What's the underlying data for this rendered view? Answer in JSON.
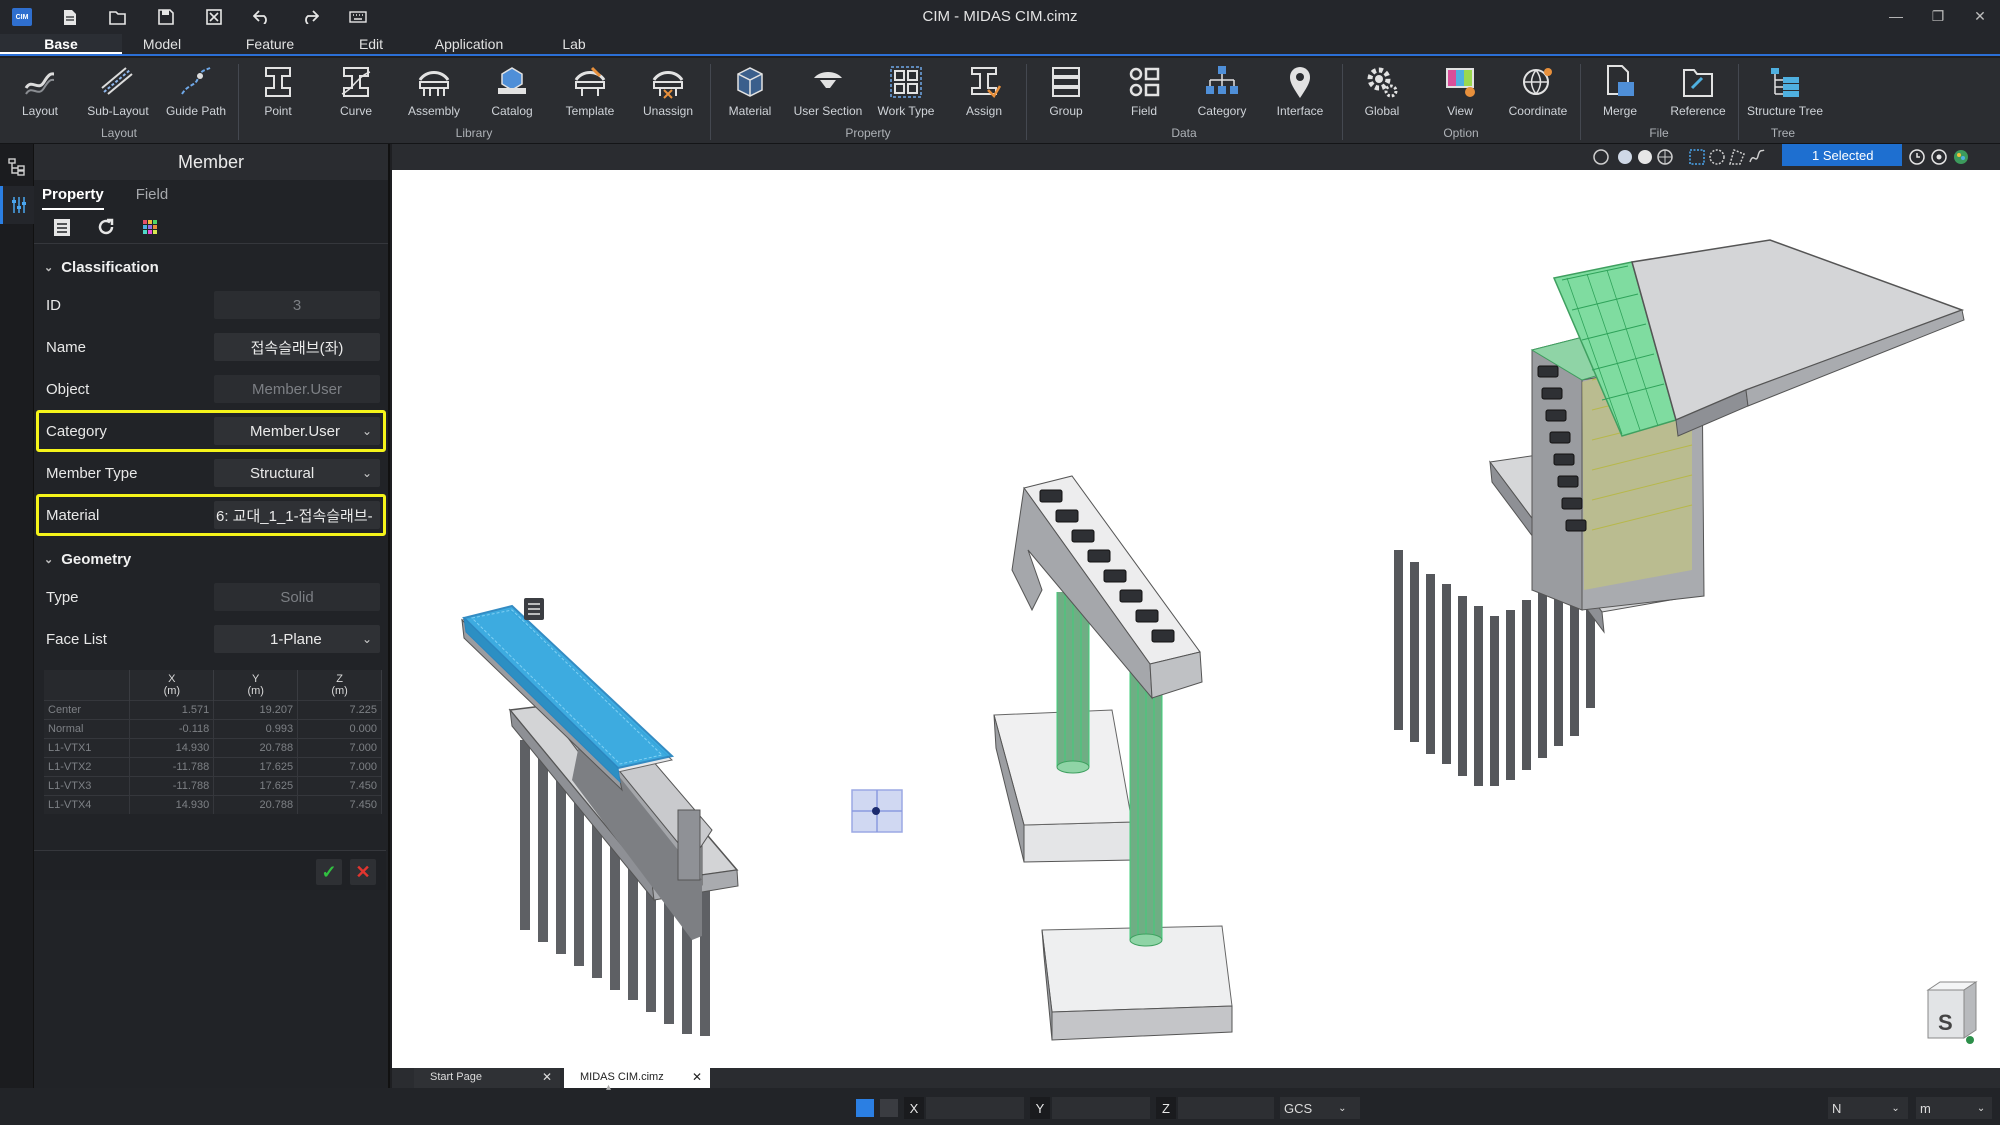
{
  "window": {
    "title": "CIM - MIDAS CIM.cimz",
    "logo_text": "CIM"
  },
  "menu": {
    "tabs": [
      "Base",
      "Model",
      "Feature",
      "Edit",
      "Application",
      "Lab"
    ],
    "active": "Base"
  },
  "ribbon": {
    "buttons": [
      "Layout",
      "Sub-Layout",
      "Guide Path",
      "Point",
      "Curve",
      "Assembly",
      "Catalog",
      "Template",
      "Unassign",
      "Material",
      "User Section",
      "Work Type",
      "Assign",
      "Group",
      "Field",
      "Category",
      "Interface",
      "Global",
      "View",
      "Coordinate",
      "Merge",
      "Reference",
      "Structure Tree"
    ],
    "groups": [
      "Layout",
      "Library",
      "Property",
      "Data",
      "Option",
      "File",
      "Tree"
    ]
  },
  "panel": {
    "title": "Member",
    "tabs": {
      "property": "Property",
      "field": "Field"
    },
    "classification": {
      "header": "Classification",
      "id_label": "ID",
      "id_value": "3",
      "name_label": "Name",
      "name_value": "접속슬래브(좌)",
      "object_label": "Object",
      "object_value": "Member.User",
      "category_label": "Category",
      "category_value": "Member.User",
      "member_type_label": "Member Type",
      "member_type_value": "Structural",
      "material_label": "Material",
      "material_value": "6: 교대_1_1-접속슬래브-"
    },
    "geometry": {
      "header": "Geometry",
      "type_label": "Type",
      "type_value": "Solid",
      "face_list_label": "Face List",
      "face_list_value": "1-Plane",
      "columns": [
        {
          "axis": "X",
          "unit": "(m)"
        },
        {
          "axis": "Y",
          "unit": "(m)"
        },
        {
          "axis": "Z",
          "unit": "(m)"
        }
      ],
      "rows": [
        {
          "name": "Center",
          "x": "1.571",
          "y": "19.207",
          "z": "7.225"
        },
        {
          "name": "Normal",
          "x": "-0.118",
          "y": "0.993",
          "z": "0.000"
        },
        {
          "name": "L1-VTX1",
          "x": "14.930",
          "y": "20.788",
          "z": "7.000"
        },
        {
          "name": "L1-VTX2",
          "x": "-11.788",
          "y": "17.625",
          "z": "7.000"
        },
        {
          "name": "L1-VTX3",
          "x": "-11.788",
          "y": "17.625",
          "z": "7.450"
        },
        {
          "name": "L1-VTX4",
          "x": "14.930",
          "y": "20.788",
          "z": "7.450"
        }
      ]
    }
  },
  "viewport_toolbar": {
    "selection": "1 Selected"
  },
  "navcube": {
    "label": "S"
  },
  "doc_tabs": [
    "Start Page",
    "MIDAS CIM.cimz"
  ],
  "status": {
    "x_label": "X",
    "y_label": "Y",
    "z_label": "Z",
    "coord_system": "GCS",
    "snap": "N",
    "unit": "m"
  },
  "colors": {
    "accent": "#2b6fd6",
    "highlight": "#f5f41a",
    "selected_slab": "#34a8e0",
    "rebar": "#3fcf7a"
  }
}
